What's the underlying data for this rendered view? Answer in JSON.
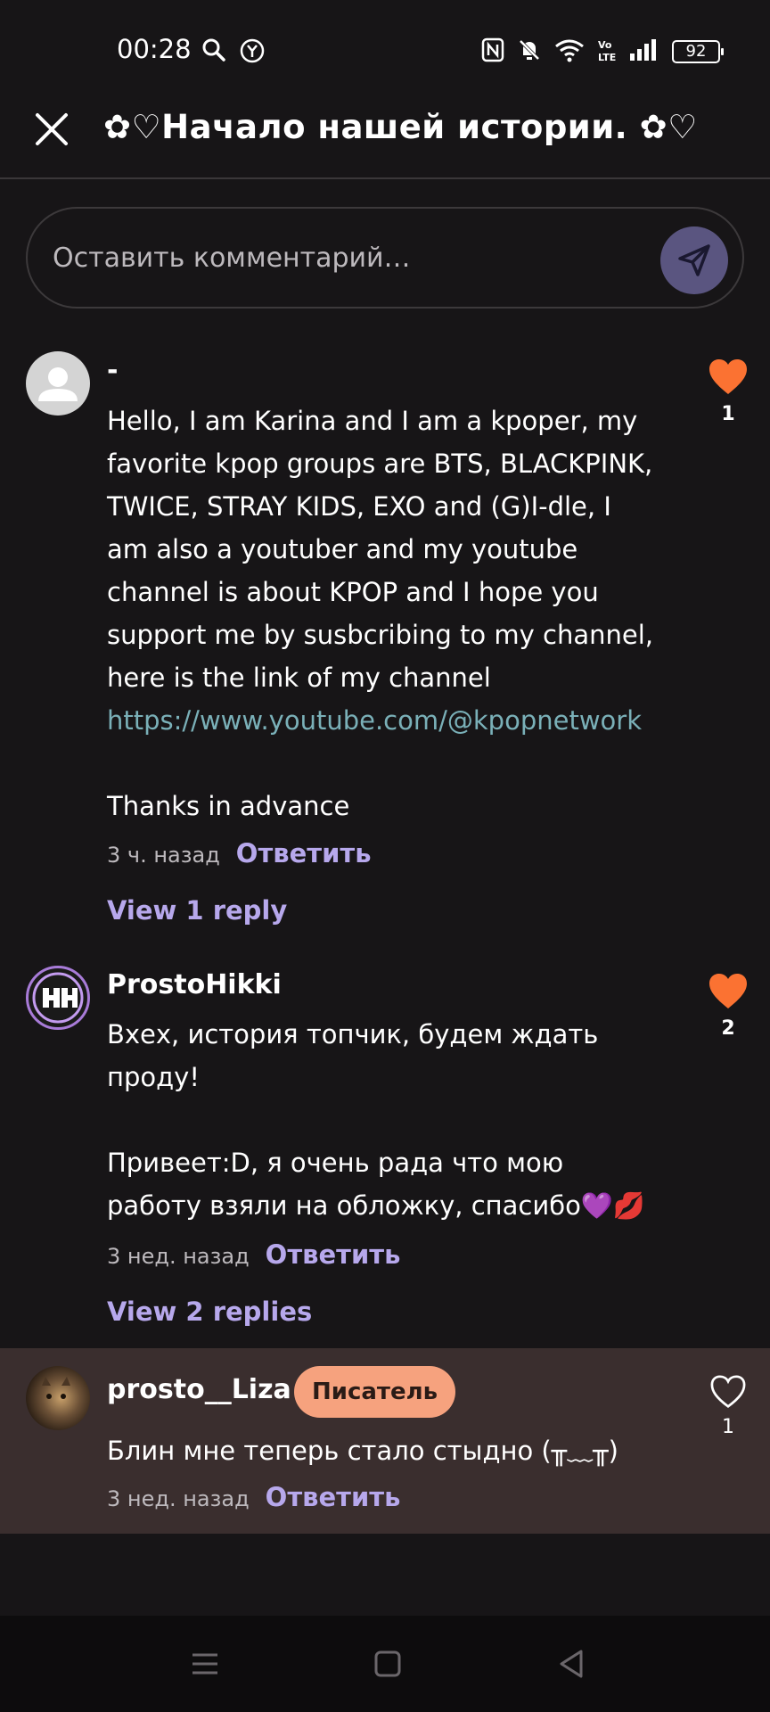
{
  "status_bar": {
    "time": "00:28",
    "battery": "92",
    "icons": [
      "search-icon",
      "target-icon",
      "nfc-icon",
      "mute-icon",
      "wifi-icon",
      "volte-icon",
      "signal-icon",
      "battery-icon"
    ]
  },
  "header": {
    "title": "✿♡Начало нашей истории. ✿♡",
    "close_icon": "close-icon"
  },
  "comment_input": {
    "placeholder": "Оставить комментарий…",
    "send_icon": "send-icon"
  },
  "comments": [
    {
      "author": "-",
      "paragraphs": [
        "Hello, I am Karina and I am a kpoper, my favorite kpop groups are BTS, BLACKPINK, TWICE, STRAY KIDS, EXO and (G)I-dle, I am also a youtuber and my youtube channel is about KPOP and I hope you support me by susbcribing to my channel, here is the link of my channel",
        "https://www.youtube.com/@kpopnetwork",
        "",
        "Thanks in advance"
      ],
      "time": "3 ч. назад",
      "reply_label": "Ответить",
      "view_replies": "View 1 reply",
      "likes": "1",
      "liked": true
    },
    {
      "author": "ProstoHikki",
      "paragraphs": [
        "Вхех, история топчик, будем ждать проду!",
        "",
        "Привеет:D, я очень рада что мою работу взяли на обложку, спасибо💜💋"
      ],
      "time": "3 нед. назад",
      "reply_label": "Ответить",
      "view_replies": "View 2 replies",
      "likes": "2",
      "liked": true
    },
    {
      "author": "prosto__Liza",
      "badge": "Писатель",
      "paragraphs": [
        "Блин мне теперь стало стыдно (╥﹏╥)"
      ],
      "time": "3 нед. назад",
      "reply_label": "Ответить",
      "likes": "1",
      "liked": false
    }
  ],
  "nav_bar": {
    "icons": [
      "menu-icon",
      "home-icon",
      "back-icon"
    ]
  },
  "colors": {
    "background": "#171517",
    "accent_purple": "#b7a8ec",
    "like_orange": "#fb7232",
    "link": "#7ab0b8",
    "badge": "#f6a27e",
    "highlight": "#3a2e2e"
  }
}
